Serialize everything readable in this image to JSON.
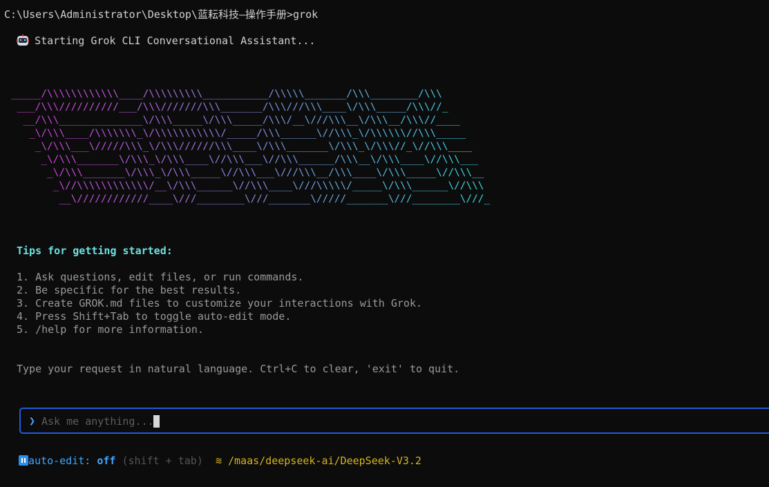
{
  "terminal": {
    "prompt": "C:\\Users\\Administrator\\Desktop\\蓝耘科技—操作手册>grok",
    "startup_icon": "robot-icon",
    "startup_message": "Starting Grok CLI Conversational Assistant..."
  },
  "banner": {
    "lines": [
      "_____/\\\\\\\\\\\\\\\\\\\\\\\\____/\\\\\\\\\\\\\\\\\\___________/\\\\\\\\\\_______/\\\\\\________/\\\\\\",
      " ___/\\\\\\//////////___/\\\\\\///////\\\\\\_______/\\\\\\///\\\\\\____\\/\\\\\\_____/\\\\\\//_",
      "  __/\\\\\\______________\\/\\\\\\_____\\/\\\\\\_____/\\\\\\/__\\///\\\\\\__\\/\\\\\\__/\\\\\\//____",
      "   _\\/\\\\\\____/\\\\\\\\\\\\\\_\\/\\\\\\\\\\\\\\\\\\\\\\/_____/\\\\\\______\\//\\\\\\_\\/\\\\\\\\\\\\//\\\\\\_____",
      "    _\\/\\\\\\___\\/////\\\\\\_\\/\\\\\\//////\\\\\\____\\/\\\\\\_______\\/\\\\\\_\\/\\\\\\//_\\//\\\\\\____",
      "     _\\/\\\\\\_______\\/\\\\\\_\\/\\\\\\____\\//\\\\\\___\\//\\\\\\______/\\\\\\__\\/\\\\\\____\\//\\\\\\___",
      "      _\\/\\\\\\_______\\/\\\\\\_\\/\\\\\\_____\\//\\\\\\___\\///\\\\\\__/\\\\\\____\\/\\\\\\_____\\//\\\\\\__",
      "       _\\//\\\\\\\\\\\\\\\\\\\\\\\\/__\\/\\\\\\______\\//\\\\\\____\\///\\\\\\\\\\/_____\\/\\\\\\______\\//\\\\\\",
      "        __\\////////////____\\///________\\///_______\\/////_______\\///________\\///_"
    ]
  },
  "tips": {
    "title": "Tips for getting started:",
    "items": [
      "1. Ask questions, edit files, or run commands.",
      "2. Be specific for the best results.",
      "3. Create GROK.md files to customize your interactions with Grok.",
      "4. Press Shift+Tab to toggle auto-edit mode.",
      "5. /help for more information."
    ],
    "hint": "Type your request in natural language. Ctrl+C to clear, 'exit' to quit."
  },
  "input": {
    "chevron": "❯",
    "placeholder": "Ask me anything...",
    "value": ""
  },
  "status": {
    "auto_edit_icon": "pause-icon",
    "auto_edit_label": "auto-edit: ",
    "auto_edit_value": "off",
    "shortcut_hint": " (shift + tab)",
    "model_icon": "≋",
    "model_path": "/maas/deepseek-ai/DeepSeek-V3.2"
  },
  "colors": {
    "background": "#0c0c0c",
    "gradient_start": "#d23bd8",
    "gradient_end": "#2ee0e0",
    "accent_blue": "#1f5ce0",
    "model_yellow": "#d6b41e"
  }
}
